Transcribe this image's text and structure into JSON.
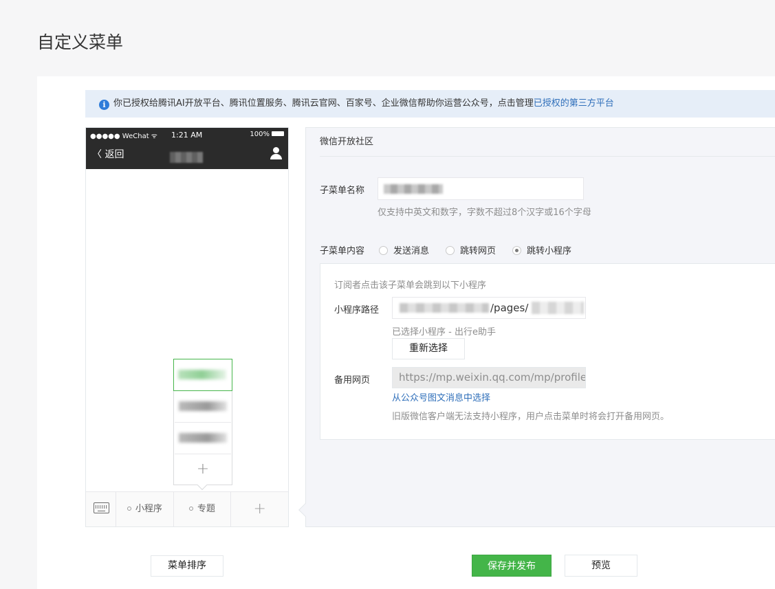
{
  "page_title": "自定义菜单",
  "notice": {
    "icon": "info-icon",
    "text": "你已授权给腾讯AI开放平台、腾讯位置服务、腾讯云官网、百家号、企业微信帮助你运营公众号，点击管理",
    "link": "已授权的第三方平台"
  },
  "phone": {
    "status": {
      "carrier": "●●●●● WeChat ᯤ",
      "time": "1:21 AM",
      "battery": "100%"
    },
    "back_label": "〈 返回",
    "sub_add": "+",
    "menu": {
      "keyboard_icon": "keyboard-icon",
      "items": [
        "小程序",
        "专题"
      ],
      "add": "+"
    }
  },
  "editor": {
    "header": "微信开放社区",
    "name_label": "子菜单名称",
    "name_hint": "仅支持中英文和数字，字数不超过8个汉字或16个字母",
    "content_label": "子菜单内容",
    "radios": [
      "发送消息",
      "跳转网页",
      "跳转小程序"
    ],
    "radio_selected": "跳转小程序",
    "box": {
      "desc": "订阅者点击该子菜单会跳到以下小程序",
      "path_label": "小程序路径",
      "path_visible": "/pages/",
      "selected_text": "已选择小程序 - 出行e助手",
      "reselect_button": "重新选择",
      "backup_label": "备用网页",
      "backup_value": "https://mp.weixin.qq.com/mp/profile_e",
      "choose_link": "从公众号图文消息中选择",
      "backup_hint": "旧版微信客户端无法支持小程序，用户点击菜单时将会打开备用网页。"
    }
  },
  "footer": {
    "sort_button": "菜单排序",
    "publish_button": "保存并发布",
    "preview_button": "预览"
  },
  "colors": {
    "accent": "#44b549",
    "link": "#2f6fba",
    "notice_bg": "#e6eef8"
  }
}
